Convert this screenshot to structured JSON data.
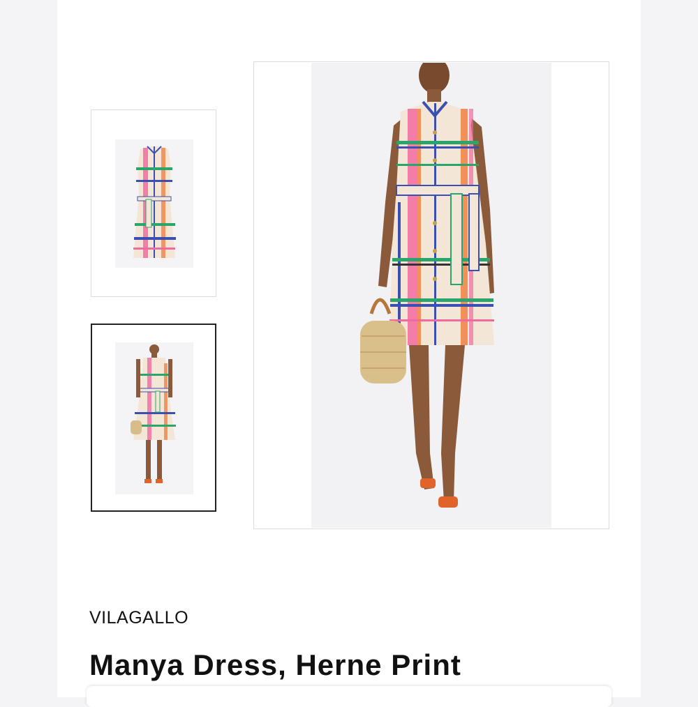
{
  "product": {
    "brand": "VILAGALLO",
    "title": "Manya Dress, Herne Print"
  },
  "gallery": {
    "selected_index": 1,
    "thumbnails": [
      {
        "view": "flat-lay"
      },
      {
        "view": "model-full-length"
      }
    ]
  },
  "colors": {
    "border_selected": "#222222",
    "border_default": "#dcdcdc",
    "dress_base": "#f3e6d6",
    "plaid_pink": "#f06aa0",
    "plaid_orange": "#f07a3a",
    "plaid_blue": "#3a4fb0",
    "plaid_green": "#2aa66c"
  }
}
